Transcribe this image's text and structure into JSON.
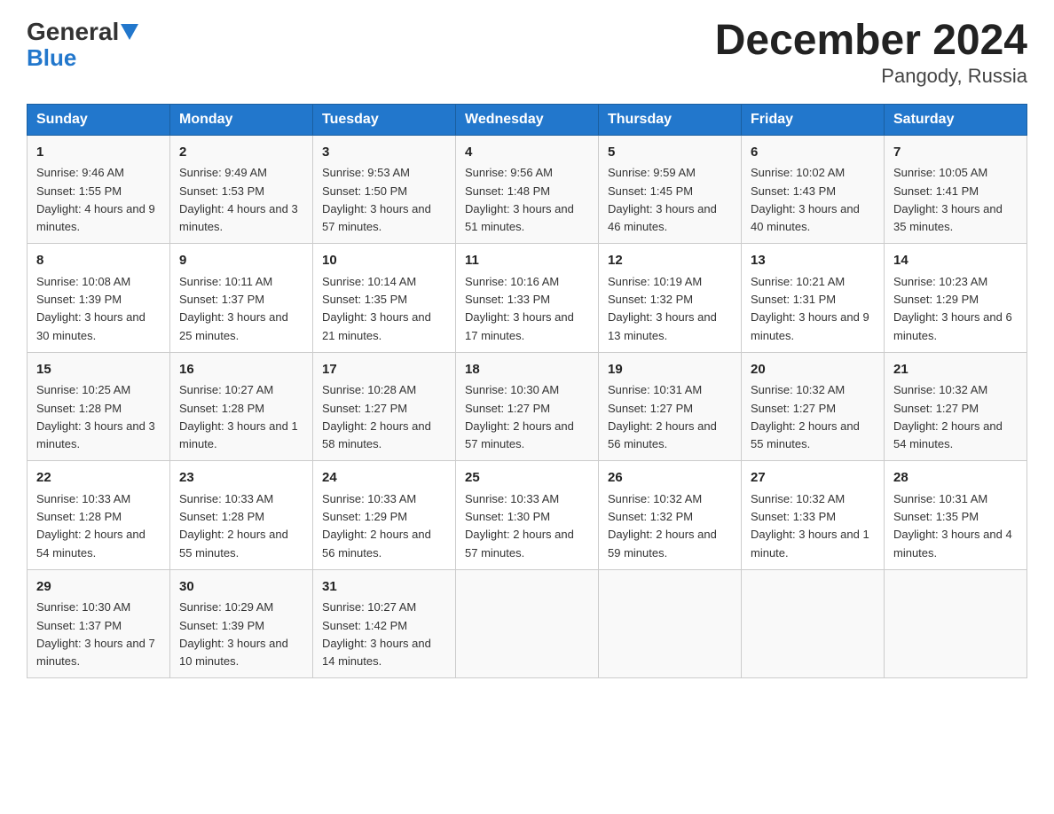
{
  "header": {
    "logo_general": "General",
    "logo_blue": "Blue",
    "title": "December 2024",
    "subtitle": "Pangody, Russia"
  },
  "days_of_week": [
    "Sunday",
    "Monday",
    "Tuesday",
    "Wednesday",
    "Thursday",
    "Friday",
    "Saturday"
  ],
  "weeks": [
    [
      {
        "day": "1",
        "sunrise": "Sunrise: 9:46 AM",
        "sunset": "Sunset: 1:55 PM",
        "daylight": "Daylight: 4 hours and 9 minutes."
      },
      {
        "day": "2",
        "sunrise": "Sunrise: 9:49 AM",
        "sunset": "Sunset: 1:53 PM",
        "daylight": "Daylight: 4 hours and 3 minutes."
      },
      {
        "day": "3",
        "sunrise": "Sunrise: 9:53 AM",
        "sunset": "Sunset: 1:50 PM",
        "daylight": "Daylight: 3 hours and 57 minutes."
      },
      {
        "day": "4",
        "sunrise": "Sunrise: 9:56 AM",
        "sunset": "Sunset: 1:48 PM",
        "daylight": "Daylight: 3 hours and 51 minutes."
      },
      {
        "day": "5",
        "sunrise": "Sunrise: 9:59 AM",
        "sunset": "Sunset: 1:45 PM",
        "daylight": "Daylight: 3 hours and 46 minutes."
      },
      {
        "day": "6",
        "sunrise": "Sunrise: 10:02 AM",
        "sunset": "Sunset: 1:43 PM",
        "daylight": "Daylight: 3 hours and 40 minutes."
      },
      {
        "day": "7",
        "sunrise": "Sunrise: 10:05 AM",
        "sunset": "Sunset: 1:41 PM",
        "daylight": "Daylight: 3 hours and 35 minutes."
      }
    ],
    [
      {
        "day": "8",
        "sunrise": "Sunrise: 10:08 AM",
        "sunset": "Sunset: 1:39 PM",
        "daylight": "Daylight: 3 hours and 30 minutes."
      },
      {
        "day": "9",
        "sunrise": "Sunrise: 10:11 AM",
        "sunset": "Sunset: 1:37 PM",
        "daylight": "Daylight: 3 hours and 25 minutes."
      },
      {
        "day": "10",
        "sunrise": "Sunrise: 10:14 AM",
        "sunset": "Sunset: 1:35 PM",
        "daylight": "Daylight: 3 hours and 21 minutes."
      },
      {
        "day": "11",
        "sunrise": "Sunrise: 10:16 AM",
        "sunset": "Sunset: 1:33 PM",
        "daylight": "Daylight: 3 hours and 17 minutes."
      },
      {
        "day": "12",
        "sunrise": "Sunrise: 10:19 AM",
        "sunset": "Sunset: 1:32 PM",
        "daylight": "Daylight: 3 hours and 13 minutes."
      },
      {
        "day": "13",
        "sunrise": "Sunrise: 10:21 AM",
        "sunset": "Sunset: 1:31 PM",
        "daylight": "Daylight: 3 hours and 9 minutes."
      },
      {
        "day": "14",
        "sunrise": "Sunrise: 10:23 AM",
        "sunset": "Sunset: 1:29 PM",
        "daylight": "Daylight: 3 hours and 6 minutes."
      }
    ],
    [
      {
        "day": "15",
        "sunrise": "Sunrise: 10:25 AM",
        "sunset": "Sunset: 1:28 PM",
        "daylight": "Daylight: 3 hours and 3 minutes."
      },
      {
        "day": "16",
        "sunrise": "Sunrise: 10:27 AM",
        "sunset": "Sunset: 1:28 PM",
        "daylight": "Daylight: 3 hours and 1 minute."
      },
      {
        "day": "17",
        "sunrise": "Sunrise: 10:28 AM",
        "sunset": "Sunset: 1:27 PM",
        "daylight": "Daylight: 2 hours and 58 minutes."
      },
      {
        "day": "18",
        "sunrise": "Sunrise: 10:30 AM",
        "sunset": "Sunset: 1:27 PM",
        "daylight": "Daylight: 2 hours and 57 minutes."
      },
      {
        "day": "19",
        "sunrise": "Sunrise: 10:31 AM",
        "sunset": "Sunset: 1:27 PM",
        "daylight": "Daylight: 2 hours and 56 minutes."
      },
      {
        "day": "20",
        "sunrise": "Sunrise: 10:32 AM",
        "sunset": "Sunset: 1:27 PM",
        "daylight": "Daylight: 2 hours and 55 minutes."
      },
      {
        "day": "21",
        "sunrise": "Sunrise: 10:32 AM",
        "sunset": "Sunset: 1:27 PM",
        "daylight": "Daylight: 2 hours and 54 minutes."
      }
    ],
    [
      {
        "day": "22",
        "sunrise": "Sunrise: 10:33 AM",
        "sunset": "Sunset: 1:28 PM",
        "daylight": "Daylight: 2 hours and 54 minutes."
      },
      {
        "day": "23",
        "sunrise": "Sunrise: 10:33 AM",
        "sunset": "Sunset: 1:28 PM",
        "daylight": "Daylight: 2 hours and 55 minutes."
      },
      {
        "day": "24",
        "sunrise": "Sunrise: 10:33 AM",
        "sunset": "Sunset: 1:29 PM",
        "daylight": "Daylight: 2 hours and 56 minutes."
      },
      {
        "day": "25",
        "sunrise": "Sunrise: 10:33 AM",
        "sunset": "Sunset: 1:30 PM",
        "daylight": "Daylight: 2 hours and 57 minutes."
      },
      {
        "day": "26",
        "sunrise": "Sunrise: 10:32 AM",
        "sunset": "Sunset: 1:32 PM",
        "daylight": "Daylight: 2 hours and 59 minutes."
      },
      {
        "day": "27",
        "sunrise": "Sunrise: 10:32 AM",
        "sunset": "Sunset: 1:33 PM",
        "daylight": "Daylight: 3 hours and 1 minute."
      },
      {
        "day": "28",
        "sunrise": "Sunrise: 10:31 AM",
        "sunset": "Sunset: 1:35 PM",
        "daylight": "Daylight: 3 hours and 4 minutes."
      }
    ],
    [
      {
        "day": "29",
        "sunrise": "Sunrise: 10:30 AM",
        "sunset": "Sunset: 1:37 PM",
        "daylight": "Daylight: 3 hours and 7 minutes."
      },
      {
        "day": "30",
        "sunrise": "Sunrise: 10:29 AM",
        "sunset": "Sunset: 1:39 PM",
        "daylight": "Daylight: 3 hours and 10 minutes."
      },
      {
        "day": "31",
        "sunrise": "Sunrise: 10:27 AM",
        "sunset": "Sunset: 1:42 PM",
        "daylight": "Daylight: 3 hours and 14 minutes."
      },
      {
        "day": "",
        "sunrise": "",
        "sunset": "",
        "daylight": ""
      },
      {
        "day": "",
        "sunrise": "",
        "sunset": "",
        "daylight": ""
      },
      {
        "day": "",
        "sunrise": "",
        "sunset": "",
        "daylight": ""
      },
      {
        "day": "",
        "sunrise": "",
        "sunset": "",
        "daylight": ""
      }
    ]
  ]
}
